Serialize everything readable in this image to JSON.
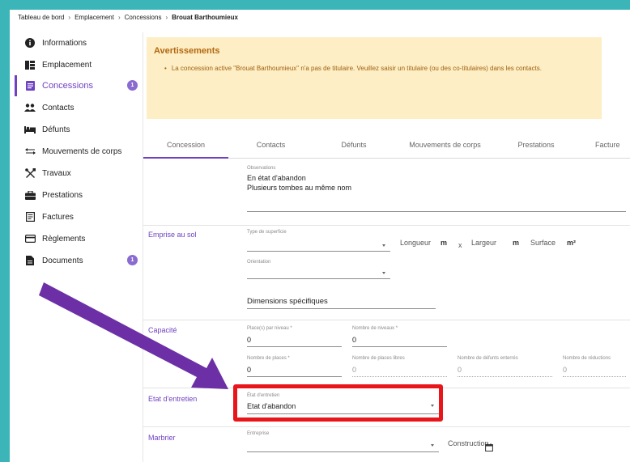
{
  "breadcrumb": {
    "items": [
      "Tableau de bord",
      "Emplacement",
      "Concessions"
    ],
    "current": "Brouat Barthoumieux",
    "separator": "›"
  },
  "sidebar": {
    "items": [
      {
        "label": "Informations",
        "icon": "info-icon"
      },
      {
        "label": "Emplacement",
        "icon": "grid-icon"
      },
      {
        "label": "Concessions",
        "icon": "document-icon",
        "active": true,
        "badge": "1"
      },
      {
        "label": "Contacts",
        "icon": "people-icon"
      },
      {
        "label": "Défunts",
        "icon": "bed-icon"
      },
      {
        "label": "Mouvements de corps",
        "icon": "swap-icon"
      },
      {
        "label": "Travaux",
        "icon": "tools-icon"
      },
      {
        "label": "Prestations",
        "icon": "briefcase-icon"
      },
      {
        "label": "Factures",
        "icon": "invoice-icon"
      },
      {
        "label": "Règlements",
        "icon": "card-icon"
      },
      {
        "label": "Documents",
        "icon": "file-icon",
        "badge": "1"
      }
    ],
    "accent": "#6f42c1"
  },
  "alert": {
    "title": "Avertissements",
    "message": "La concession active \"Brouat Barthoumieux\" n'a pas de titulaire. Veuillez saisir un titulaire (ou des co-titulaires) dans les contacts."
  },
  "tabs": [
    {
      "label": "Concession",
      "active": true
    },
    {
      "label": "Contacts"
    },
    {
      "label": "Défunts"
    },
    {
      "label": "Mouvements de corps"
    },
    {
      "label": "Prestations"
    },
    {
      "label": "Facture"
    }
  ],
  "observations": {
    "label": "Observations",
    "line1": "En état d'abandon",
    "line2": "Plusieurs tombes au même nom"
  },
  "emprise": {
    "section": "Emprise au sol",
    "type_label": "Type de superficie",
    "longueur": "Longueur",
    "largeur": "Largeur",
    "surface": "Surface",
    "unit_m": "m",
    "unit_m2": "m²",
    "x": "x",
    "orientation_label": "Orientation",
    "dimensions_label": "Dimensions spécifiques"
  },
  "capacite": {
    "section": "Capacité",
    "places_niveau_label": "Place(s) par niveau *",
    "places_niveau_value": "0",
    "nb_niveaux_label": "Nombre de niveaux *",
    "nb_niveaux_value": "0",
    "nb_places_label": "Nombre de places *",
    "nb_places_value": "0",
    "places_libres_label": "Nombre de places libres",
    "places_libres_value": "0",
    "defunts_enteres_label": "Nombre de défunts enterrés",
    "defunts_enteres_value": "0",
    "reductions_label": "Nombre de réductions",
    "reductions_value": "0"
  },
  "entretien": {
    "section": "Etat d'entretien",
    "label": "État d'entretien",
    "value": "Etat d'abandon"
  },
  "marbrier": {
    "section": "Marbrier",
    "entreprise_label": "Entreprise",
    "construction_label": "Construction"
  },
  "colors": {
    "teal_border": "#3bb5b8",
    "alert_bg": "#fdeec6",
    "highlight": "#e8161b",
    "arrow": "#6d2fa6"
  }
}
